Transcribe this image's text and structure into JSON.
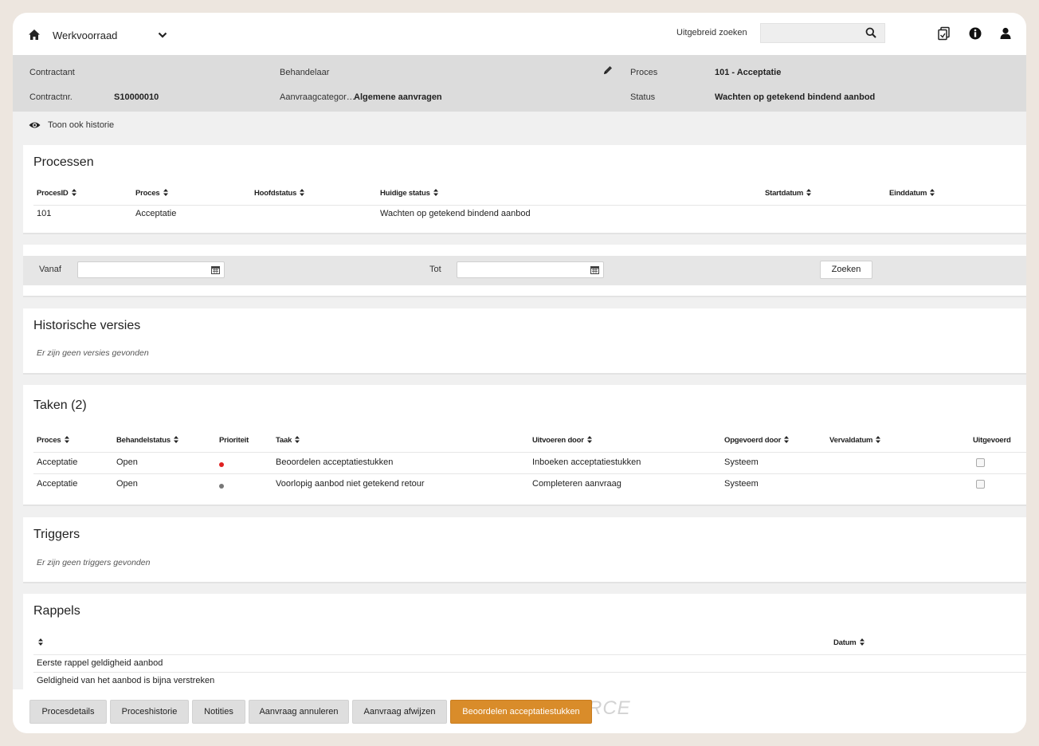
{
  "topbar": {
    "title": "Werkvoorraad",
    "advanced_search_label": "Uitgebreid zoeken",
    "search_value": "",
    "icons": [
      "home-icon",
      "chevron-down-icon",
      "search-icon",
      "copy-document-icon",
      "info-icon",
      "user-icon"
    ]
  },
  "header": {
    "contractant_label": "Contractant",
    "contractant_value": "",
    "contractnr_label": "Contractnr.",
    "contractnr_value": "S10000010",
    "behandelaar_label": "Behandelaar",
    "behandelaar_value": "",
    "aanvraagcategorie_label": "Aanvraagcategor…",
    "aanvraagcategorie_value": "Algemene aanvragen",
    "proces_label": "Proces",
    "proces_value": "101 - Acceptatie",
    "status_label": "Status",
    "status_value": "Wachten op getekend bindend aanbod"
  },
  "history_toggle_label": "Toon ook historie",
  "processen": {
    "title": "Processen",
    "columns": [
      "ProcesID",
      "Proces",
      "Hoofdstatus",
      "Huidige status",
      "Startdatum",
      "Einddatum"
    ],
    "rows": [
      [
        "101",
        "Acceptatie",
        "",
        "Wachten op getekend bindend aanbod",
        "",
        ""
      ]
    ]
  },
  "filter": {
    "vanaf_label": "Vanaf",
    "vanaf_value": "",
    "tot_label": "Tot",
    "tot_value": "",
    "search_button": "Zoeken"
  },
  "historische_versies": {
    "title": "Historische versies",
    "empty_text": "Er zijn geen versies gevonden"
  },
  "taken": {
    "title": "Taken (2)",
    "columns": [
      "Proces",
      "Behandelstatus",
      "Prioriteit",
      "Taak",
      "Uitvoeren door",
      "Opgevoerd door",
      "Vervaldatum",
      "Uitgevoerd"
    ],
    "rows": [
      {
        "proces": "Acceptatie",
        "behandelstatus": "Open",
        "priority_color": "#e02020",
        "taak": "Beoordelen acceptatiestukken",
        "uitvoeren_door": "Inboeken acceptatiestukken",
        "opgevoerd_door": "Systeem",
        "vervaldatum": "",
        "uitgevoerd": false
      },
      {
        "proces": "Acceptatie",
        "behandelstatus": "Open",
        "priority_color": "#777777",
        "taak": "Voorlopig aanbod niet getekend retour",
        "uitvoeren_door": "Completeren aanvraag",
        "opgevoerd_door": "Systeem",
        "vervaldatum": "",
        "uitgevoerd": false
      }
    ]
  },
  "triggers": {
    "title": "Triggers",
    "empty_text": "Er zijn geen triggers gevonden"
  },
  "rappels": {
    "title": "Rappels",
    "columns": [
      "",
      "Datum"
    ],
    "rows": [
      [
        "Eerste rappel geldigheid aanbod",
        ""
      ],
      [
        "Geldigheid van het aanbod is bijna verstreken",
        ""
      ]
    ]
  },
  "actions": {
    "watermark": "RCE",
    "buttons": [
      "Procesdetails",
      "Proceshistorie",
      "Notities",
      "Aanvraag annuleren",
      "Aanvraag afwijzen",
      "Beoordelen acceptatiestukken"
    ],
    "primary_color": "#d98c2a"
  }
}
